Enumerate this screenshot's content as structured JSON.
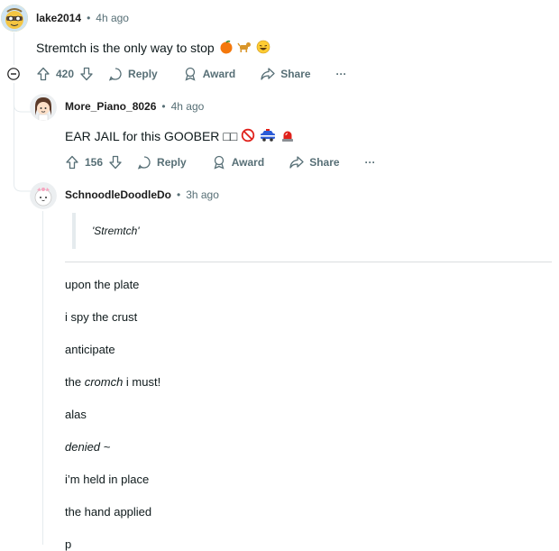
{
  "comments": [
    {
      "username": "lake2014",
      "time": "4h ago",
      "text": "Stremtch is the only way to stop",
      "emojis": [
        "orange-emoji",
        "dog-emoji",
        "laughing-emoji"
      ],
      "votes": "420",
      "actions": {
        "reply": "Reply",
        "award": "Award",
        "share": "Share"
      }
    },
    {
      "username": "More_Piano_8026",
      "time": "4h ago",
      "text": "EAR JAIL for this GOOBER",
      "text_tail": "□□",
      "emojis": [
        "no-entry-emoji",
        "police-car-emoji",
        "siren-emoji"
      ],
      "votes": "156",
      "actions": {
        "reply": "Reply",
        "award": "Award",
        "share": "Share"
      }
    },
    {
      "username": "SchnoodleDoodleDo",
      "time": "3h ago",
      "quote": "'Stremtch'",
      "poem": [
        "upon the plate",
        "i spy the crust",
        "anticipate"
      ],
      "poem_line4_pre": "the ",
      "poem_line4_em": "cromch",
      "poem_line4_post": " i must!",
      "poem_line5": "alas",
      "poem_line6": "denied ~",
      "poem_line7": "i’m held in place",
      "poem_line8": "the hand applied",
      "poem_line9": "p"
    }
  ],
  "separator": "•",
  "more": "···",
  "colors": {
    "meta": "#576f76",
    "line": "#e5ebee",
    "text": "#0f1a1c"
  }
}
